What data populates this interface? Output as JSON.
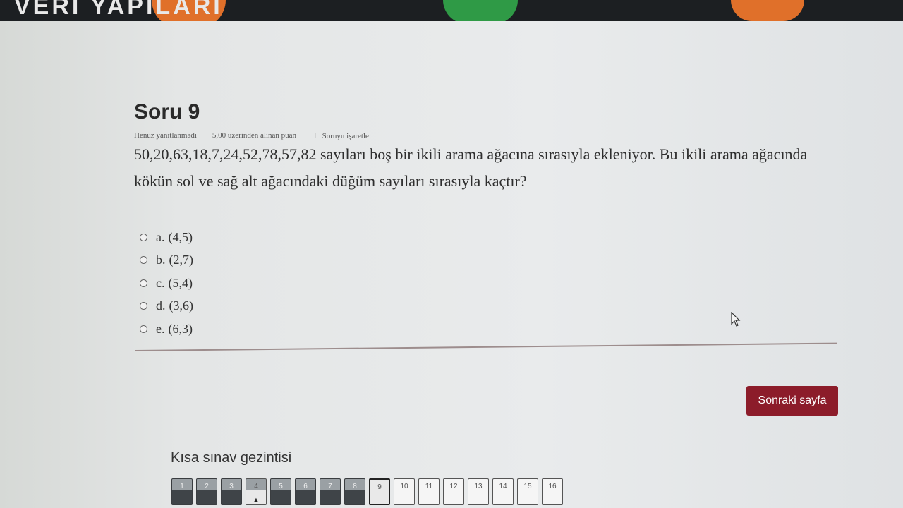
{
  "banner": {
    "text": "VERİ YAPILARI"
  },
  "question": {
    "title": "Soru 9",
    "status": "Henüz yanıtlanmadı",
    "grade": "5,00 üzerinden alınan puan",
    "flag_label": "Soruyu işaretle",
    "text": "50,20,63,18,7,24,52,78,57,82 sayıları boş bir ikili arama ağacına sırasıyla ekleniyor. Bu ikili arama ağacında kökün sol ve sağ alt ağacındaki düğüm sayıları sırasıyla kaçtır?",
    "answers": [
      {
        "letter": "a.",
        "text": "(4,5)"
      },
      {
        "letter": "b.",
        "text": "(2,7)"
      },
      {
        "letter": "c.",
        "text": "(5,4)"
      },
      {
        "letter": "d.",
        "text": "(3,6)"
      },
      {
        "letter": "e.",
        "text": "(6,3)"
      }
    ]
  },
  "next_button": "Sonraki sayfa",
  "quiz_nav": {
    "title": "Kısa sınav gezintisi",
    "buttons": [
      {
        "label": "1",
        "state": "answered"
      },
      {
        "label": "2",
        "state": "answered"
      },
      {
        "label": "3",
        "state": "answered"
      },
      {
        "label": "4",
        "state": "flagged"
      },
      {
        "label": "5",
        "state": "answered"
      },
      {
        "label": "6",
        "state": "answered"
      },
      {
        "label": "7",
        "state": "answered"
      },
      {
        "label": "8",
        "state": "answered"
      },
      {
        "label": "9",
        "state": "current"
      },
      {
        "label": "10",
        "state": "empty"
      },
      {
        "label": "11",
        "state": "empty"
      },
      {
        "label": "12",
        "state": "empty"
      },
      {
        "label": "13",
        "state": "empty"
      },
      {
        "label": "14",
        "state": "empty"
      },
      {
        "label": "15",
        "state": "empty"
      },
      {
        "label": "16",
        "state": "empty"
      }
    ]
  },
  "colors": {
    "accent": "#8c1c2a",
    "topbar": "#1c1f22"
  },
  "icons": {
    "flag": "flag-icon",
    "cursor": "mouse-pointer-icon"
  }
}
